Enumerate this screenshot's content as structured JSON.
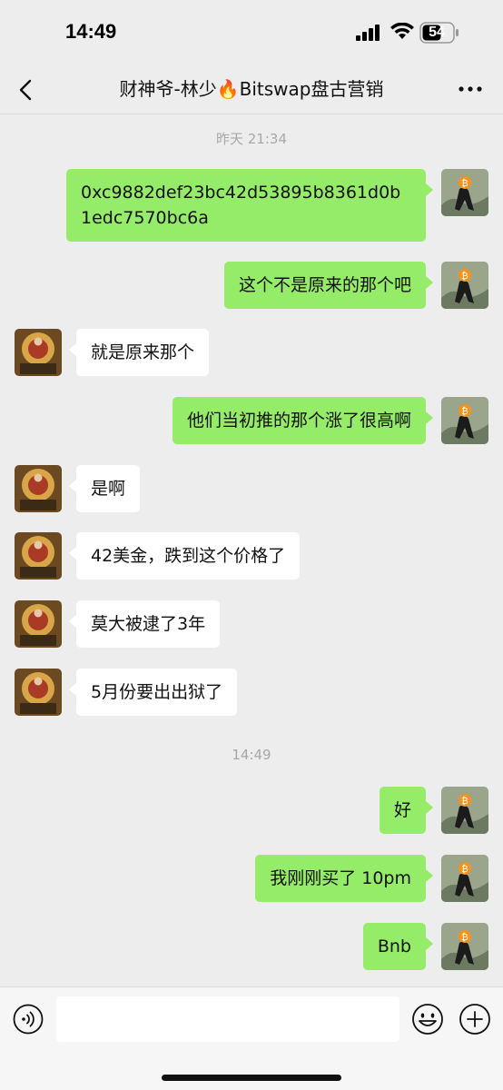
{
  "status_bar": {
    "time": "14:49",
    "battery": "54"
  },
  "nav": {
    "title": "财神爷-林少🔥Bitswap盘古营销"
  },
  "messages": [
    {
      "type": "time",
      "text": "昨天 21:34"
    },
    {
      "type": "sent",
      "text": "0xc9882def23bc42d53895b8361d0b1edc7570bc6a"
    },
    {
      "type": "sent",
      "text": "这个不是原来的那个吧"
    },
    {
      "type": "received",
      "text": "就是原来那个"
    },
    {
      "type": "sent",
      "text": "他们当初推的那个涨了很高啊"
    },
    {
      "type": "received",
      "text": "是啊"
    },
    {
      "type": "received",
      "text": "42美金，跌到这个价格了"
    },
    {
      "type": "received",
      "text": "莫大被逮了3年"
    },
    {
      "type": "received",
      "text": "5月份要出出狱了"
    },
    {
      "type": "time",
      "text": "14:49"
    },
    {
      "type": "sent",
      "text": "好"
    },
    {
      "type": "sent",
      "text": "我刚刚买了 10pm"
    },
    {
      "type": "sent",
      "text": "Bnb"
    }
  ],
  "colors": {
    "background": "#ededed",
    "sent_bubble": "#95ec69",
    "received_bubble": "#ffffff"
  },
  "icons": {
    "back": "chevron-left-icon",
    "more": "more-dots-icon",
    "voice": "voice-icon",
    "emoji": "emoji-icon",
    "add": "plus-circle-icon"
  }
}
